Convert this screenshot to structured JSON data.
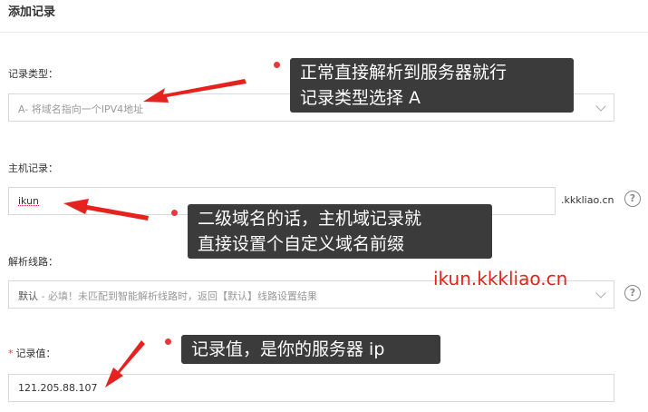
{
  "header": {
    "title": "添加记录"
  },
  "form": {
    "record_type": {
      "label": "记录类型：",
      "value": "A- 将域名指向一个IPV4地址"
    },
    "host_record": {
      "label": "主机记录：",
      "value": "ikun",
      "suffix": ".kkkliao.cn",
      "help": "?"
    },
    "line": {
      "label": "解析线路：",
      "value": "默认",
      "hint": " - 必填！未匹配到智能解析线路时，返回【默认】线路设置结果",
      "help": "?"
    },
    "record_value": {
      "required_mark": "*",
      "label": "记录值：",
      "value": "121.205.88.107"
    }
  },
  "annotations": {
    "note1": "正常直接解析到服务器就行\n记录类型选择 A",
    "note2": "二级域名的话，主机域记录就\n直接设置个自定义域名前缀",
    "domain_text": "ikun.kkkliao.cn",
    "note3": "记录值，是你的服务器 ip",
    "color": "#e4231e"
  }
}
